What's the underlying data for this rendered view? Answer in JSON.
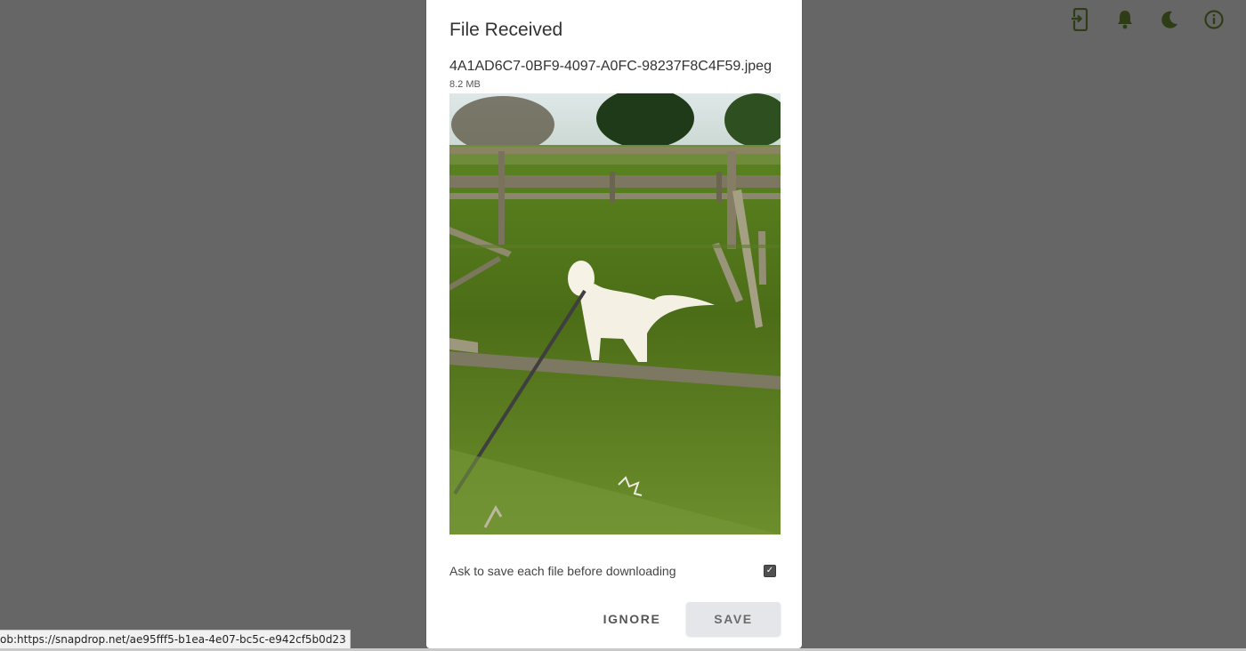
{
  "header": {
    "icons": [
      {
        "name": "install-app-icon",
        "color": "#2f3d16"
      },
      {
        "name": "bell-icon",
        "color": "#2f3d16"
      },
      {
        "name": "moon-icon",
        "color": "#2f3d16"
      },
      {
        "name": "info-icon",
        "color": "#2f3d16"
      }
    ]
  },
  "dialog": {
    "title": "File Received",
    "file_name": "4A1AD6C7-0BF9-4097-A0FC-98237F8C4F59.jpeg",
    "file_size": "8.2 MB",
    "preview_icon": "dog-photo",
    "ask_label": "Ask to save each file before downloading",
    "ask_checked": true,
    "ignore_label": "IGNORE",
    "save_label": "SAVE"
  },
  "status_bar": {
    "url": "ob:https://snapdrop.net/ae95fff5-b1ea-4e07-bc5c-e942cf5b0d23"
  },
  "colors": {
    "backdrop": "#666666",
    "icon": "#2f3d16",
    "dialog_bg": "#ffffff",
    "save_button_bg": "#e4e6ea"
  }
}
